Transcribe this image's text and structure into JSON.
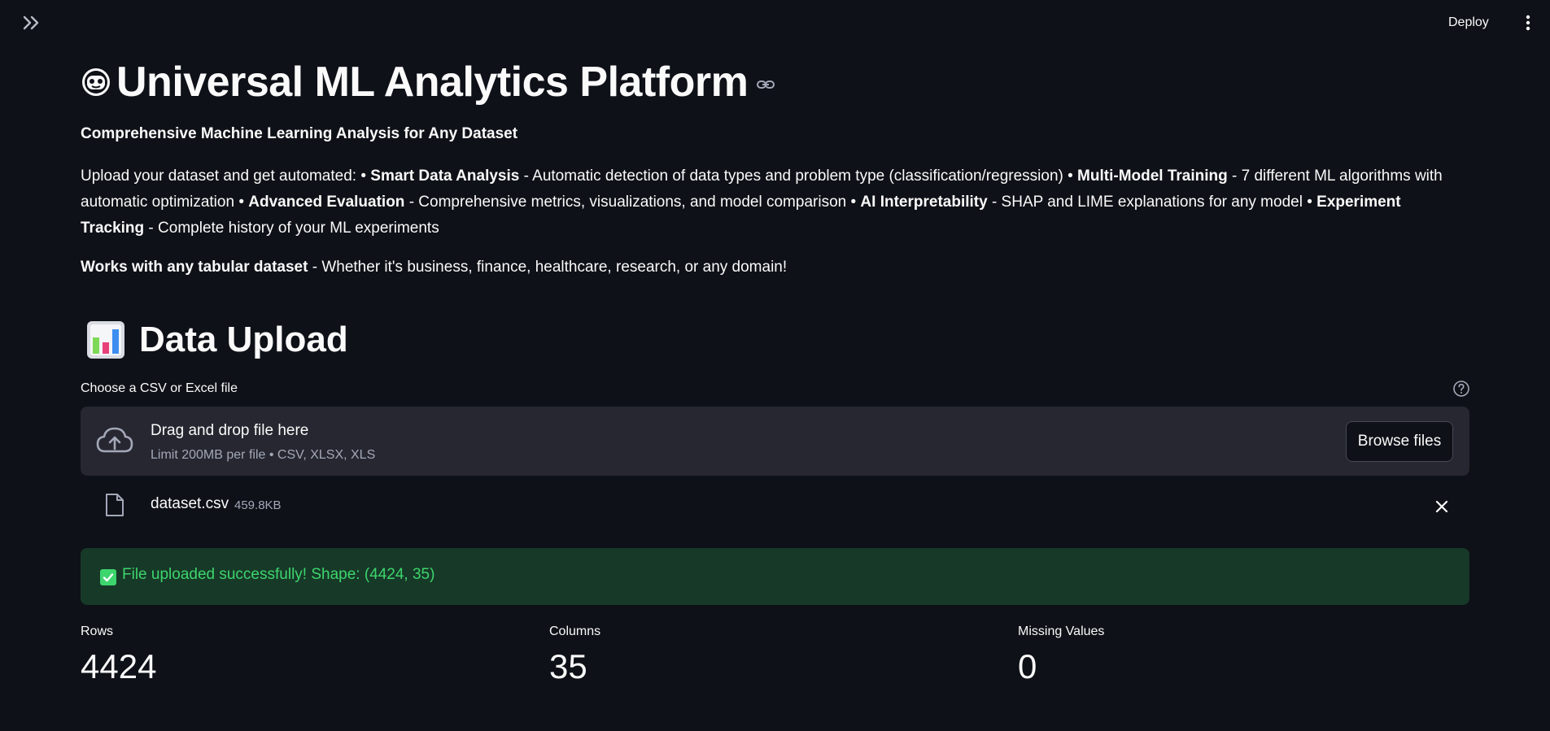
{
  "topbar": {
    "deploy_label": "Deploy"
  },
  "header": {
    "title": "Universal ML Analytics Platform",
    "subtitle": "Comprehensive Machine Learning Analysis for Any Dataset"
  },
  "description": {
    "intro": "Upload your dataset and get automated: • ",
    "f1_title": "Smart Data Analysis",
    "f1_text": " - Automatic detection of data types and problem type (classification/regression) • ",
    "f2_title": "Multi-Model Training",
    "f2_text": " - 7 different ML algorithms with automatic optimization • ",
    "f3_title": "Advanced Evaluation",
    "f3_text": " - Comprehensive metrics, visualizations, and model comparison • ",
    "f4_title": "AI Interpretability",
    "f4_text": " - SHAP and LIME explanations for any model • ",
    "f5_title": "Experiment Tracking",
    "f5_text": " - Complete history of your ML experiments"
  },
  "works": {
    "bold": "Works with any tabular dataset",
    "rest": " - Whether it's business, finance, healthcare, research, or any domain!"
  },
  "upload": {
    "section_title": "Data Upload",
    "label": "Choose a CSV or Excel file",
    "dropzone_title": "Drag and drop file here",
    "dropzone_limit": "Limit 200MB per file • CSV, XLSX, XLS",
    "browse_label": "Browse files",
    "file_name": "dataset.csv",
    "file_size": "459.8KB"
  },
  "status": {
    "success_message": "File uploaded successfully! Shape: (4424, 35)",
    "success_color": "#3dd56d"
  },
  "metrics": [
    {
      "label": "Rows",
      "value": "4424"
    },
    {
      "label": "Columns",
      "value": "35"
    },
    {
      "label": "Missing Values",
      "value": "0"
    }
  ],
  "icons": {
    "sidebar": "double-chevron-right-icon",
    "menu": "kebab-menu-icon",
    "title": "robot-face-icon",
    "anchor": "link-icon",
    "section": "bar-chart-icon",
    "help": "help-circle-icon",
    "upload": "cloud-upload-icon",
    "file": "file-icon",
    "remove": "close-icon",
    "success": "check-box-icon"
  }
}
